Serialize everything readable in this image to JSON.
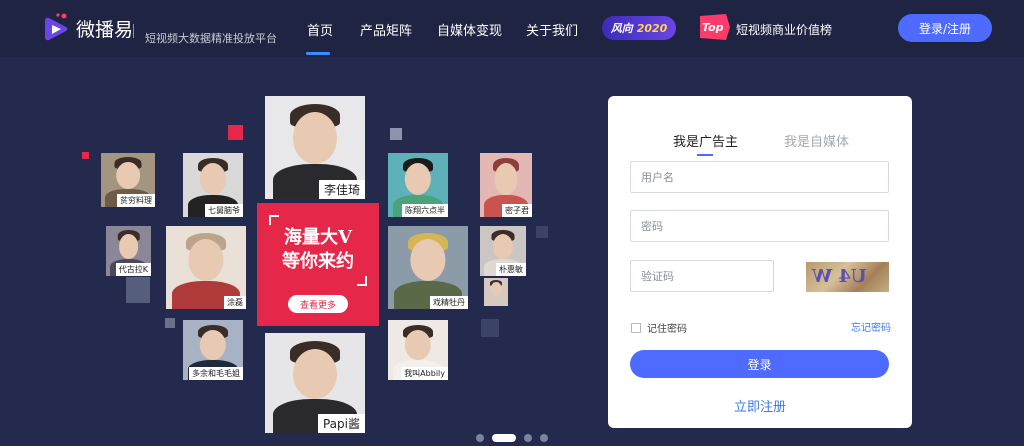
{
  "header": {
    "logo_name": "微播易",
    "slogan": "短视频大数据精准投放平台",
    "nav": [
      {
        "label": "首页",
        "active": true
      },
      {
        "label": "产品矩阵",
        "active": false
      },
      {
        "label": "自媒体变现",
        "active": false
      },
      {
        "label": "关于我们",
        "active": false
      }
    ],
    "badge_fengxiang": {
      "word": "风向",
      "year": "2020"
    },
    "top_logo_text": "Top",
    "top_list_label": "短视频商业价值榜",
    "login_register_label": "登录/注册",
    "accent_color": "#4f6bff"
  },
  "hero": {
    "influencers": [
      "贫穷料理",
      "七舅脑爷",
      "李佳琦",
      "陈翔六点半",
      "密子君",
      "代古拉K",
      "涂磊",
      "戏精牡丹",
      "朴惠敏",
      "多余和毛毛姐",
      "我叫Abbily",
      "Papi酱"
    ],
    "promo": {
      "line1": "海量大V",
      "line2": "等你来约",
      "see_more": "查看更多",
      "color": "#e5284a"
    },
    "carousel": {
      "count": 4,
      "active_index": 1
    }
  },
  "login": {
    "tabs": [
      {
        "label": "我是广告主",
        "active": true
      },
      {
        "label": "我是自媒体",
        "active": false
      }
    ],
    "username_placeholder": "用户名",
    "password_placeholder": "密码",
    "captcha_placeholder": "验证码",
    "captcha_text": "U4 W",
    "remember_label": "记住密码",
    "forgot_label": "忘记密码",
    "login_label": "登录",
    "register_label": "立即注册"
  }
}
